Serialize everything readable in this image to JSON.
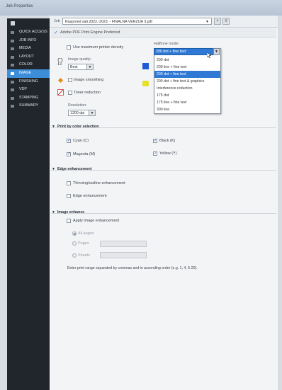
{
  "window": {
    "title": "Job Properties"
  },
  "sidebar": {
    "items": [
      {
        "label": "QUICK ACCESS",
        "active": false
      },
      {
        "label": "JOB INFO",
        "active": false
      },
      {
        "label": "MEDIA",
        "active": false
      },
      {
        "label": "LAYOUT",
        "active": false
      },
      {
        "label": "COLOR",
        "active": false
      },
      {
        "label": "IMAGE",
        "active": true
      },
      {
        "label": "FINISHING",
        "active": false
      },
      {
        "label": "VDP",
        "active": false
      },
      {
        "label": "STAMPING",
        "active": false
      },
      {
        "label": "SUMMARY",
        "active": false
      }
    ]
  },
  "jobbar": {
    "label": "Job",
    "file": "Raspored sati 2022.-2023. - FINALNA VERZIJA 3.pdf",
    "icon_a": "+",
    "icon_b": "≡"
  },
  "pdf_engine": {
    "label": "Adobe PDF Print Engine Preferred",
    "checked": true
  },
  "image": {
    "max_density_label": "Use maximum printer density",
    "image_quality_label": "Image quality:",
    "image_quality_value": "Best",
    "image_smoothing_label": "Image smoothing",
    "toner_reduction_label": "Toner reduction",
    "resolution_label": "Resolution:",
    "resolution_value": "1200 dpi"
  },
  "halftone": {
    "label": "Halftone mode:",
    "current": "200 dot + fine text",
    "options": [
      "200 dot",
      "200 line + fine text",
      "200 dot + fine text",
      "200 dot + fine text & graphics",
      "Interference reduction",
      "175 dot",
      "175 line + fine text",
      "300 line"
    ],
    "selected_index": 2
  },
  "print_by_color": {
    "title": "Print by color selection",
    "cyan": "Cyan (C)",
    "black": "Black (K)",
    "magenta": "Magenta (M)",
    "yellow": "Yellow (Y)"
  },
  "edge": {
    "title": "Edge enhancement",
    "thinning": "Thinning/outline enhancement",
    "edge_label": "Edge enhancement"
  },
  "enhance": {
    "title": "Image enhance",
    "apply_label": "Apply image enhancement",
    "all_pages": "All pages",
    "pages": "Pages",
    "sheets": "Sheets",
    "hint": "Enter print range separated by commas and in ascending order (e.g. 1, 4, 5-20)."
  },
  "colors": {
    "accent": "#2f79d4",
    "sidebar_bg": "#21262d",
    "active_item": "#3d8ed8",
    "swatch_blue": "#1e5bd6",
    "swatch_yellow": "#e7e02a"
  }
}
